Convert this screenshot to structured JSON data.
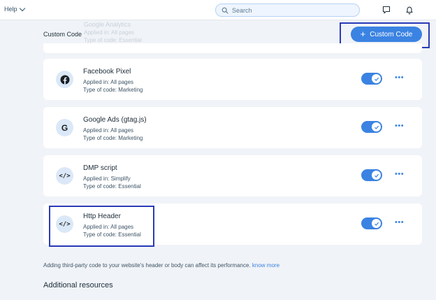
{
  "topbar": {
    "help_label": "Help",
    "search_placeholder": "Search"
  },
  "section": {
    "title": "Custom Code",
    "add_button_label": "Custom Code",
    "ghost_lines": [
      "Google Analytics",
      "Applied in: All pages",
      "Type of code: Essential"
    ]
  },
  "snippets": [
    {
      "name": "Facebook Pixel",
      "applied": "Applied in: All pages",
      "type": "Type of code: Marketing",
      "icon": "facebook-icon",
      "enabled": true
    },
    {
      "name": "Google Ads (gtag.js)",
      "applied": "Applied in: All pages",
      "type": "Type of code: Marketing",
      "icon": "google-icon",
      "enabled": true
    },
    {
      "name": "DMP script",
      "applied": "Applied in: Simplify",
      "type": "Type of code: Essential",
      "icon": "code-icon",
      "enabled": true
    },
    {
      "name": "Http Header",
      "applied": "Applied in: All pages",
      "type": "Type of code: Essential",
      "icon": "code-icon",
      "enabled": true
    }
  ],
  "footer": {
    "note": "Adding third-party code to your website's header or body can affect its performance.",
    "link": "know more",
    "additional_title": "Additional resources"
  },
  "colors": {
    "accent": "#3b83e2",
    "highlight": "#2a3bb8",
    "background": "#f0f3f7"
  }
}
